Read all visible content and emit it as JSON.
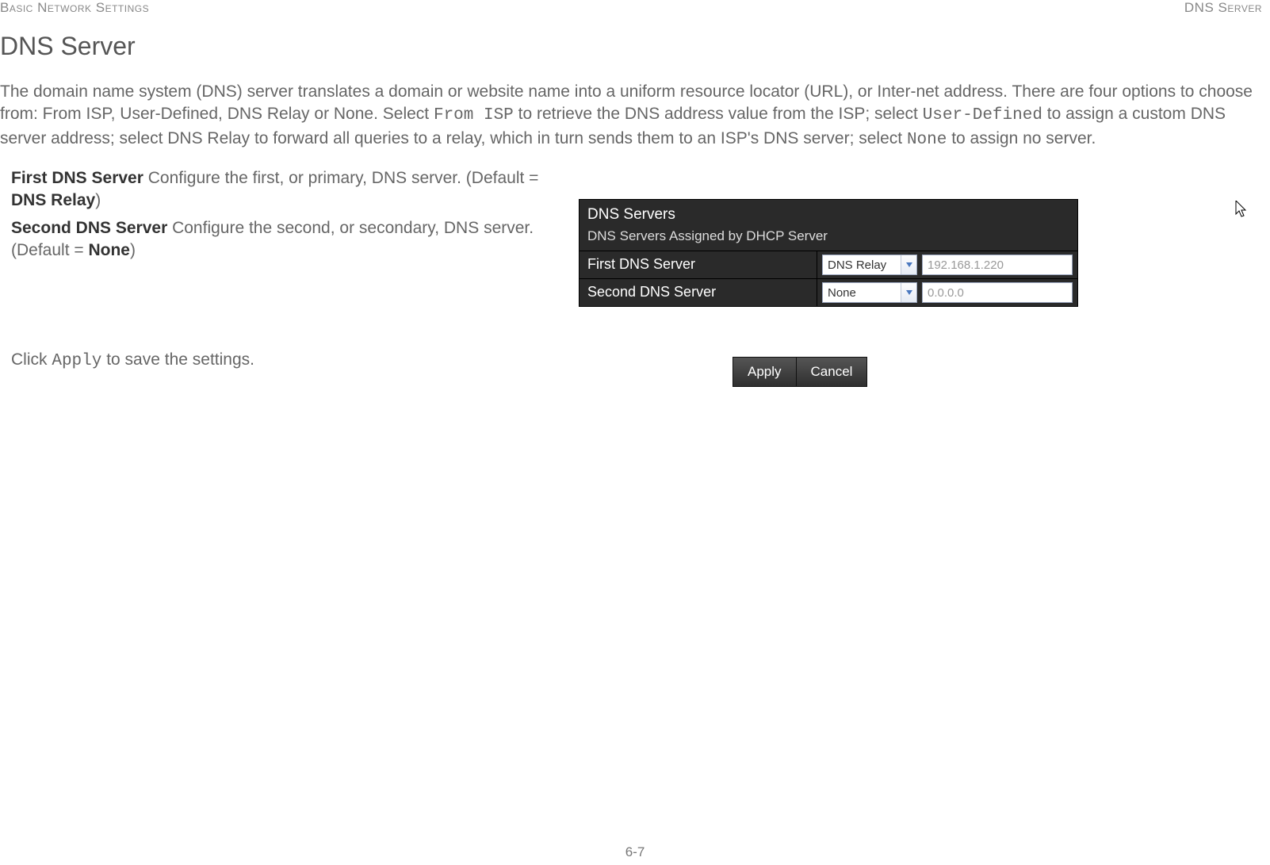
{
  "header": {
    "left": "Basic Network Settings",
    "right": "DNS Server"
  },
  "title": "DNS Server",
  "intro": {
    "p1a": "The domain name system (DNS) server translates a domain or website name into a uniform resource locator (URL), or Inter-net address. There are four options to choose from: From ISP, User-Defined, DNS Relay or None. Select ",
    "m1": "From ISP",
    "p1b": " to retrieve the DNS address value from the ISP; select ",
    "m2": "User-Defined",
    "p1c": " to assign a custom DNS server address; select DNS Relay to forward all queries to a relay, which in turn sends them to an ISP's DNS server; select ",
    "m3": "None",
    "p1d": " to assign no server."
  },
  "definitions": {
    "first_label": "First DNS Server",
    "first_text_a": "  Configure the first, or primary, DNS server. (Default = ",
    "first_default": "DNS Relay",
    "first_text_b": ")",
    "second_label": "Second DNS Server",
    "second_text_a": "  Configure the second, or secondary, DNS server. (Default = ",
    "second_default": "None",
    "second_text_b": ")"
  },
  "panel": {
    "title": "DNS Servers",
    "subtitle": "DNS Servers Assigned by DHCP Server",
    "rows": [
      {
        "label": "First DNS Server",
        "select": "DNS Relay",
        "ip": "192.168.1.220"
      },
      {
        "label": "Second DNS Server",
        "select": "None",
        "ip": "0.0.0.0"
      }
    ]
  },
  "apply": {
    "text_a": "Click ",
    "mono": "Apply",
    "text_b": " to save the settings."
  },
  "buttons": {
    "apply": "Apply",
    "cancel": "Cancel"
  },
  "page_number": "6-7"
}
